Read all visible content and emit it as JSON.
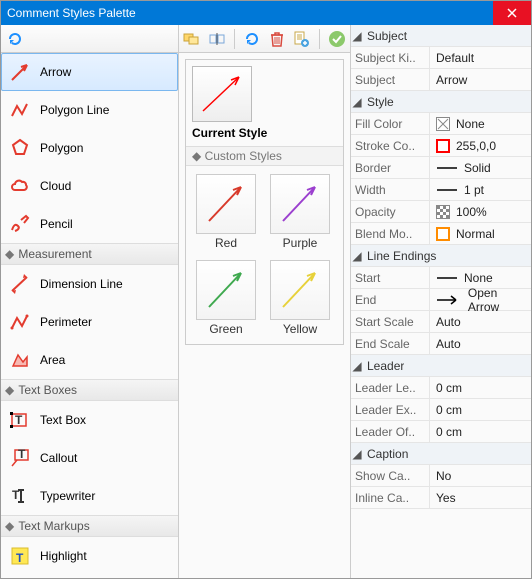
{
  "window": {
    "title": "Comment Styles Palette"
  },
  "left_groups": [
    {
      "items": [
        {
          "name": "arrow",
          "label": "Arrow",
          "selected": true,
          "icon": "arrow"
        },
        {
          "name": "polygon-line",
          "label": "Polygon Line",
          "icon": "polyline"
        },
        {
          "name": "polygon",
          "label": "Polygon",
          "icon": "polygon"
        },
        {
          "name": "cloud",
          "label": "Cloud",
          "icon": "cloud"
        },
        {
          "name": "pencil",
          "label": "Pencil",
          "icon": "pencil"
        }
      ]
    },
    {
      "header": "Measurement",
      "items": [
        {
          "name": "dimension-line",
          "label": "Dimension Line",
          "icon": "dimline"
        },
        {
          "name": "perimeter",
          "label": "Perimeter",
          "icon": "perimeter"
        },
        {
          "name": "area",
          "label": "Area",
          "icon": "area"
        }
      ]
    },
    {
      "header": "Text Boxes",
      "items": [
        {
          "name": "text-box",
          "label": "Text Box",
          "icon": "textbox"
        },
        {
          "name": "callout",
          "label": "Callout",
          "icon": "callout"
        },
        {
          "name": "typewriter",
          "label": "Typewriter",
          "icon": "typewriter"
        }
      ]
    },
    {
      "header": "Text Markups",
      "items": [
        {
          "name": "highlight",
          "label": "Highlight",
          "icon": "highlight"
        }
      ]
    }
  ],
  "mid": {
    "current_label": "Current Style",
    "custom_header": "Custom Styles",
    "tiles": [
      {
        "name": "red",
        "label": "Red",
        "color": "#d83a2b"
      },
      {
        "name": "purple",
        "label": "Purple",
        "color": "#9b3fcf"
      },
      {
        "name": "green",
        "label": "Green",
        "color": "#3fa94f"
      },
      {
        "name": "yellow",
        "label": "Yellow",
        "color": "#e7d13a"
      }
    ]
  },
  "props": [
    {
      "section": "Subject"
    },
    {
      "key": "Subject Ki..",
      "val": "Default"
    },
    {
      "key": "Subject",
      "val": "Arrow"
    },
    {
      "section": "Style"
    },
    {
      "key": "Fill Color",
      "val": "None",
      "swatch": "none"
    },
    {
      "key": "Stroke Co..",
      "val": "255,0,0",
      "swatch": "#ff0000"
    },
    {
      "key": "Border",
      "val": "Solid",
      "preview": "line"
    },
    {
      "key": "Width",
      "val": "1 pt",
      "preview": "line"
    },
    {
      "key": "Opacity",
      "val": "100%",
      "swatch": "checker"
    },
    {
      "key": "Blend Mo..",
      "val": "Normal",
      "swatch": "#ff8c00"
    },
    {
      "section": "Line Endings"
    },
    {
      "key": "Start",
      "val": "None",
      "preview": "line"
    },
    {
      "key": "End",
      "val": "Open Arrow",
      "preview": "arrow"
    },
    {
      "key": "Start Scale",
      "val": "Auto"
    },
    {
      "key": "End Scale",
      "val": "Auto"
    },
    {
      "section": "Leader"
    },
    {
      "key": "Leader Le..",
      "val": "0 cm"
    },
    {
      "key": "Leader Ex..",
      "val": "0 cm"
    },
    {
      "key": "Leader Of..",
      "val": "0 cm"
    },
    {
      "section": "Caption"
    },
    {
      "key": "Show Ca..",
      "val": "No"
    },
    {
      "key": "Inline Ca..",
      "val": "Yes"
    }
  ],
  "colors": {
    "accent": "#0078d7",
    "tool_red": "#e33b2e"
  }
}
